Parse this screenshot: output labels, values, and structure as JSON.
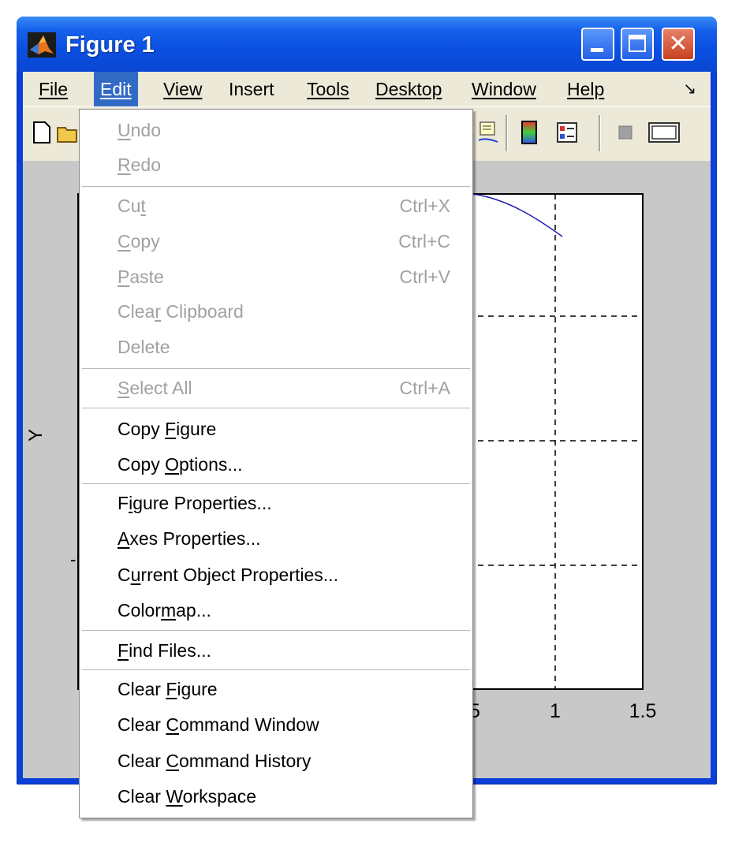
{
  "window": {
    "title": "Figure 1",
    "close_symbol": "✕"
  },
  "menubar": {
    "items": [
      "File",
      "Edit",
      "View",
      "Insert",
      "Tools",
      "Desktop",
      "Window",
      "Help"
    ],
    "overflow_icon": "↘",
    "active": "Edit"
  },
  "axes": {
    "ylabel": "Y",
    "x_ticks": [
      "5",
      "1",
      "1.5"
    ]
  },
  "edit_menu": {
    "items": [
      {
        "label": "Undo",
        "mnemonic": "U",
        "shortcut": "",
        "enabled": false
      },
      {
        "label": "Redo",
        "mnemonic": "R",
        "shortcut": "",
        "enabled": false
      },
      {
        "label": "Cut",
        "mnemonic": "t",
        "shortcut": "Ctrl+X",
        "enabled": false
      },
      {
        "label": "Copy",
        "mnemonic": "C",
        "shortcut": "Ctrl+C",
        "enabled": false
      },
      {
        "label": "Paste",
        "mnemonic": "P",
        "shortcut": "Ctrl+V",
        "enabled": false
      },
      {
        "label": "Clear Clipboard",
        "mnemonic": "r",
        "shortcut": "",
        "enabled": false
      },
      {
        "label": "Delete",
        "mnemonic": "",
        "shortcut": "",
        "enabled": false
      },
      {
        "label": "Select All",
        "mnemonic": "S",
        "shortcut": "Ctrl+A",
        "enabled": false
      },
      {
        "label": "Copy Figure",
        "mnemonic": "F",
        "shortcut": "",
        "enabled": true
      },
      {
        "label": "Copy Options...",
        "mnemonic": "O",
        "shortcut": "",
        "enabled": true
      },
      {
        "label": "Figure Properties...",
        "mnemonic": "i",
        "shortcut": "",
        "enabled": true
      },
      {
        "label": "Axes Properties...",
        "mnemonic": "A",
        "shortcut": "",
        "enabled": true
      },
      {
        "label": "Current Object Properties...",
        "mnemonic": "u",
        "shortcut": "",
        "enabled": true
      },
      {
        "label": "Colormap...",
        "mnemonic": "m",
        "shortcut": "",
        "enabled": true
      },
      {
        "label": "Find Files...",
        "mnemonic": "F",
        "shortcut": "",
        "enabled": true
      },
      {
        "label": "Clear Figure",
        "mnemonic": "F",
        "shortcut": "",
        "enabled": true
      },
      {
        "label": "Clear Command Window",
        "mnemonic": "C",
        "shortcut": "",
        "enabled": true
      },
      {
        "label": "Clear Command History",
        "mnemonic": "C",
        "shortcut": "",
        "enabled": true
      },
      {
        "label": "Clear Workspace",
        "mnemonic": "W",
        "shortcut": "",
        "enabled": true
      }
    ]
  },
  "colors": {
    "title_bar": "#0a4fe0",
    "menu_highlight": "#316ac5",
    "plot_line": "#1a1aa8",
    "disabled_text": "#a1a1a1"
  }
}
